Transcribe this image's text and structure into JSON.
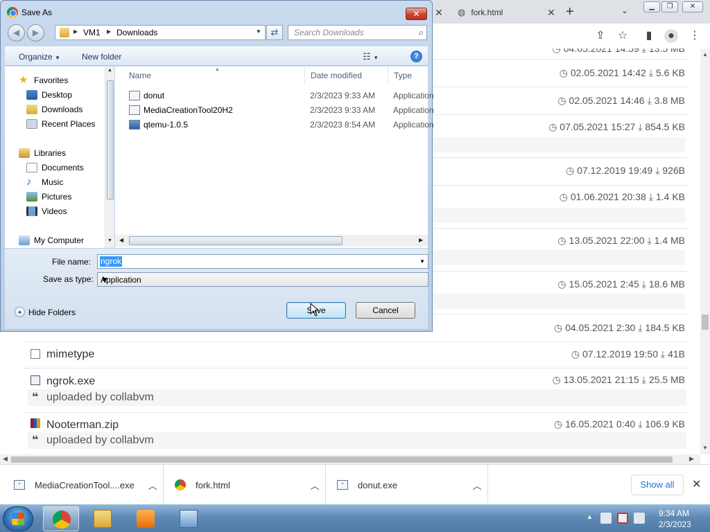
{
  "browser": {
    "tabs": [
      {
        "title": "fork.html"
      }
    ],
    "new_tab_label": "+"
  },
  "listing": {
    "rows": [
      {
        "name": "",
        "date": "04.05.2021 14:59",
        "size": "13.5 MB",
        "partial": true
      },
      {
        "name": "",
        "date": "02.05.2021 14:42",
        "size": "5.6 KB"
      },
      {
        "name": "",
        "date": "02.05.2021 14:46",
        "size": "3.8 MB"
      },
      {
        "name": "",
        "date": "07.05.2021 15:27",
        "size": "854.5 KB"
      },
      {
        "name": "",
        "date": "07.12.2019 19:49",
        "size": "926B"
      },
      {
        "name": "",
        "date": "01.06.2021 20:38",
        "size": "1.4 KB"
      },
      {
        "name": "",
        "date": "13.05.2021 22:00",
        "size": "1.4 MB"
      },
      {
        "name": "",
        "date": "15.05.2021 2:45",
        "size": "18.6 MB"
      },
      {
        "name": "",
        "date": "04.05.2021 2:30",
        "size": "184.5 KB"
      },
      {
        "name": "mimetype",
        "date": "07.12.2019 19:50",
        "size": "41B"
      },
      {
        "name": "ngrok.exe",
        "date": "13.05.2021 21:15",
        "size": "25.5 MB",
        "note": "uploaded by collabvm"
      },
      {
        "name": "Nooterman.zip",
        "date": "16.05.2021 0:40",
        "size": "106.9 KB",
        "note": "uploaded by collabvm"
      }
    ]
  },
  "downloads": {
    "items": [
      {
        "name": "MediaCreationTool....exe"
      },
      {
        "name": "fork.html"
      },
      {
        "name": "donut.exe"
      }
    ],
    "show_all": "Show all"
  },
  "dialog": {
    "title": "Save As",
    "path": [
      "VM1",
      "Downloads"
    ],
    "search_placeholder": "Search Downloads",
    "organize_label": "Organize",
    "new_folder_label": "New folder",
    "nav": {
      "favorites": "Favorites",
      "desktop": "Desktop",
      "downloads": "Downloads",
      "recent": "Recent Places",
      "libraries": "Libraries",
      "documents": "Documents",
      "music": "Music",
      "pictures": "Pictures",
      "videos": "Videos",
      "computer": "My Computer"
    },
    "columns": {
      "name": "Name",
      "date": "Date modified",
      "type": "Type"
    },
    "files": [
      {
        "name": "donut",
        "date": "2/3/2023 9:33 AM",
        "type": "Application"
      },
      {
        "name": "MediaCreationTool20H2",
        "date": "2/3/2023 9:33 AM",
        "type": "Application"
      },
      {
        "name": "qtemu-1.0.5",
        "date": "2/3/2023 8:54 AM",
        "type": "Application"
      }
    ],
    "file_name_label": "File name:",
    "file_name_value": "ngrok",
    "save_type_label": "Save as type:",
    "save_type_value": "Application",
    "hide_folders": "Hide Folders",
    "save_label": "Save",
    "cancel_label": "Cancel"
  },
  "taskbar": {
    "time": "9:34 AM",
    "date": "2/3/2023"
  },
  "colors": {
    "accent_link": "#1a73e8",
    "selection": "#3399ff",
    "close_red": "#c8472f"
  }
}
